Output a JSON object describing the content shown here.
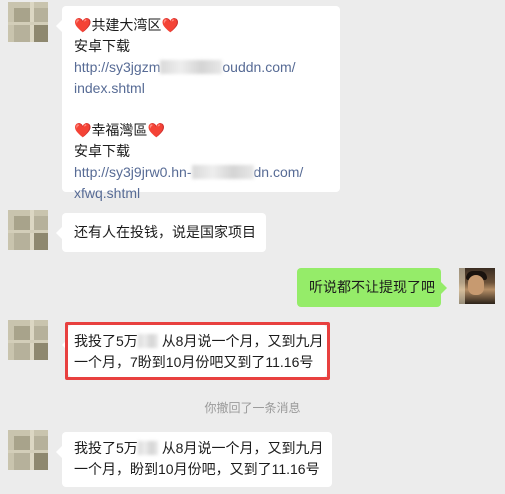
{
  "messages": [
    {
      "lines": [
        {
          "heart_before": "❤️",
          "text": "共建大湾区",
          "heart_after": "❤️"
        },
        {
          "text": "安卓下载"
        },
        {
          "link_start": "http://sy3jgzm",
          "link_end": "ouddn.com/"
        },
        {
          "link": "index.shtml"
        },
        {
          "heart_before": "❤️",
          "text": "幸福灣區",
          "heart_after": "❤️"
        },
        {
          "text": "安卓下载"
        },
        {
          "link_start": "http://sy3j9jrw0.hn-",
          "link_end": "dn.com/"
        },
        {
          "link": "xfwq.shtml"
        }
      ]
    },
    {
      "text": "还有人在投钱，说是国家项目"
    },
    {
      "text": "听说都不让提现了吧",
      "from_self": true
    },
    {
      "line1_start": "我投了5万",
      "line1_end": "从8月说一个月，又到九月",
      "line2": "一个月，7盼到10月份吧又到了11.16号",
      "highlighted": true
    },
    {
      "line1_start": "我投了5万",
      "line1_end": "从8月说一个月，又到九月",
      "line2": "一个月，盼到10月份吧，又到了11.16号"
    }
  ],
  "system_notice": "你撤回了一条消息",
  "colors": {
    "self_bubble": "#95ec69",
    "link": "#576b95",
    "highlight_border": "#e8403f",
    "heart": "#e11a2b"
  }
}
